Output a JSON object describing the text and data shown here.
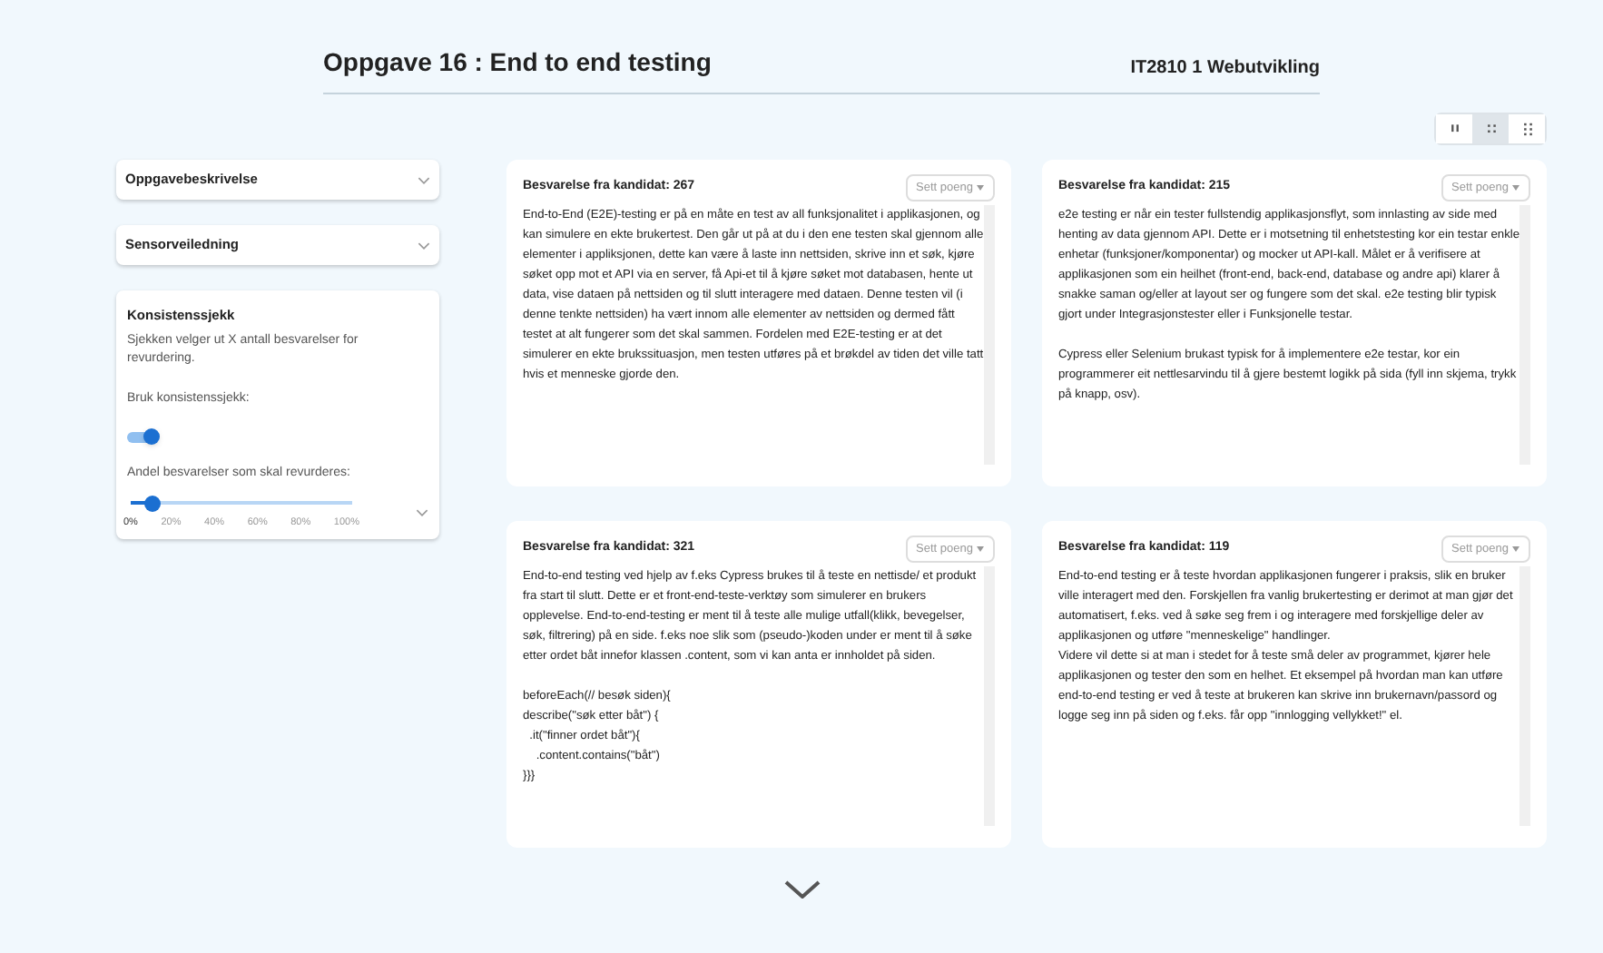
{
  "header": {
    "title": "Oppgave 16 : End to end testing",
    "course": "IT2810 1 Webutvikling"
  },
  "view_options": [
    {
      "kind": "columns-2",
      "selected": false
    },
    {
      "kind": "grid-4",
      "selected": true
    },
    {
      "kind": "grid-6",
      "selected": false
    }
  ],
  "sidebar": {
    "sections": [
      {
        "title": "Oppgavebeskrivelse",
        "expanded": false
      },
      {
        "title": "Sensorveiledning",
        "expanded": false
      }
    ],
    "consistency": {
      "title": "Konsistenssjekk",
      "description": "Sjekken velger ut X antall besvarelser for revurdering.",
      "toggle_label": "Bruk konsistenssjekk:",
      "toggle_on": true,
      "slider_label": "Andel besvarelser som skal revurderes:",
      "level": 0.1,
      "ticks": [
        "0%",
        "20%",
        "40%",
        "60%",
        "80%",
        "100%"
      ]
    }
  },
  "answers": [
    {
      "heading": "Besvarelse fra kandidat: 267",
      "button": "Sett poeng",
      "text": "End-to-End (E2E)-testing er på en måte en test av all funksjonalitet i applikasjonen, og kan simulere en ekte brukertest. Den går ut på at du i den ene testen skal gjennom alle elementer i appliksjonen, dette kan være å laste inn nettsiden, skrive inn et søk, kjøre søket opp mot et API via en server, få Api-et til å kjøre søket mot databasen, hente ut data, vise dataen på nettsiden og til slutt interagere med dataen. Denne testen vil (i denne tenkte nettsiden) ha vært innom alle elementer av nettsiden og dermed fått testet at alt fungerer som det skal sammen. Fordelen med E2E-testing er at det simulerer en ekte brukssituasjon, men testen utføres på et brøkdel av tiden det ville tatt hvis et menneske gjorde den."
    },
    {
      "heading": "Besvarelse fra kandidat: 215",
      "button": "Sett poeng",
      "text": "e2e testing er når ein tester fullstendig applikasjonsflyt, som innlasting av side med henting av data gjennom API. Dette er i motsetning til enhetstesting kor ein testar enkle enhetar (funksjoner/komponentar) og mocker ut API-kall. Målet er å verifisere at applikasjonen som ein heilhet (front-end, back-end, database og andre api) klarer å snakke saman og/eller at layout ser og fungere som det skal. e2e testing blir typisk gjort under Integrasjonstester eller i Funksjonelle testar.\n\nCypress eller Selenium brukast typisk for å implementere e2e testar, kor ein programmerer eit nettlesarvindu til å gjere bestemt logikk på sida (fyll inn skjema, trykk på knapp, osv)."
    },
    {
      "heading": "Besvarelse fra kandidat: 321",
      "button": "Sett poeng",
      "text": "End-to-end testing ved hjelp av f.eks Cypress brukes til å teste en nettisde/ et produkt fra start til slutt. Dette er et front-end-teste-verktøy som simulerer en brukers opplevelse. End-to-end-testing er ment til å teste alle mulige utfall(klikk, bevegelser, søk, filtrering) på en side. f.eks noe slik som (pseudo-)koden under er ment til å søke etter ordet båt innefor klassen .content, som vi kan anta er innholdet på siden.\n\nbeforeEach(// besøk siden){\ndescribe(\"søk etter båt\") {\n  .it(\"finner ordet båt\"){\n    .content.contains(\"båt\")\n}}}"
    },
    {
      "heading": "Besvarelse fra kandidat: 119",
      "button": "Sett poeng",
      "text": "End-to-end testing er å teste hvordan applikasjonen fungerer i praksis, slik en bruker ville interagert med den. Forskjellen fra vanlig brukertesting er derimot at man gjør det automatisert, f.eks. ved å søke seg frem i og interagere med forskjellige deler av applikasjonen og utføre \"menneskelige\" handlinger.\nVidere vil dette si at man i stedet for å teste små deler av programmet, kjører hele applikasjonen og tester den som en helhet. Et eksempel på hvordan man kan utføre end-to-end testing er ved å teste at brukeren kan skrive inn brukernavn/passord og logge seg inn på siden og f.eks. får opp \"innlogging vellykket!\" el."
    }
  ]
}
